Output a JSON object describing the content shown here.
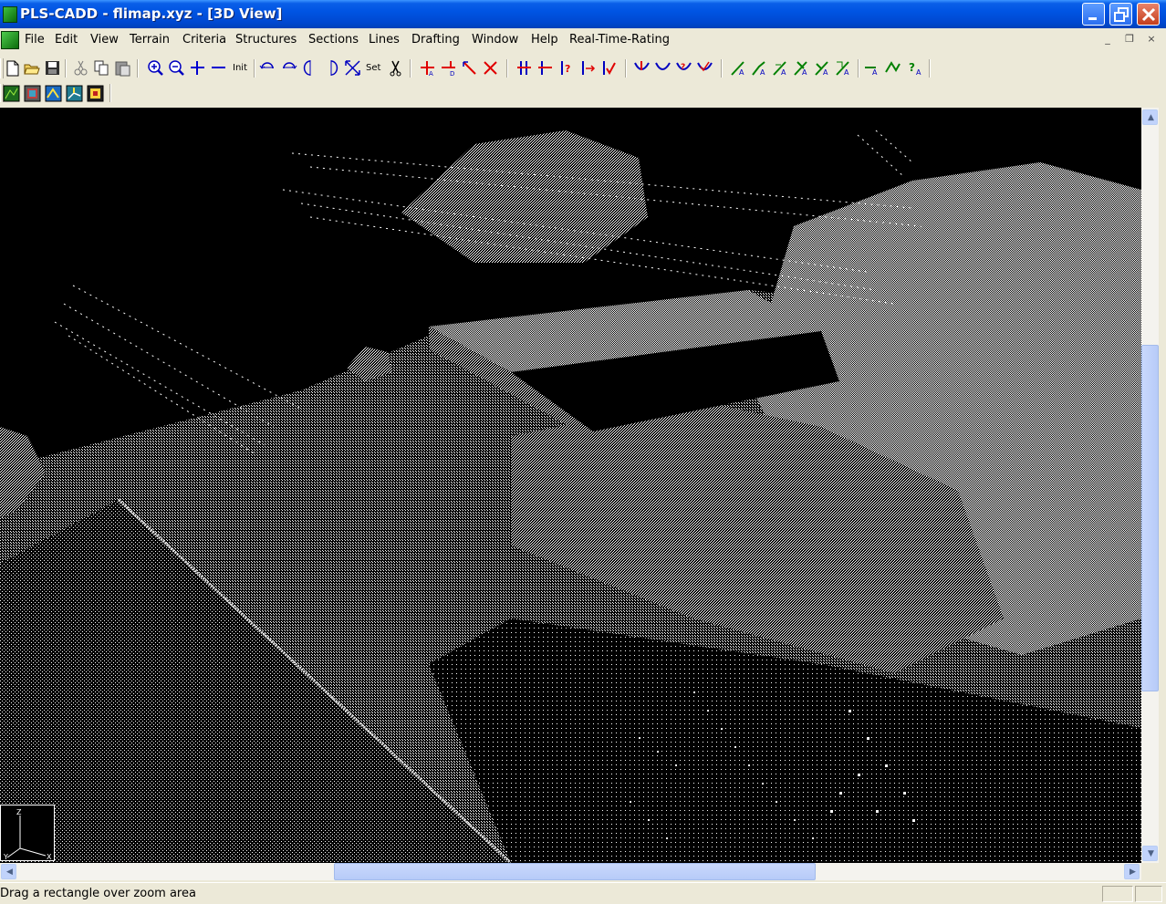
{
  "window": {
    "title": "PLS-CADD - flimap.xyz - [3D View]",
    "title_bar_color": "#0054e3",
    "controls": [
      "minimize",
      "maximize",
      "close"
    ]
  },
  "menubar": {
    "items": [
      "File",
      "Edit",
      "View",
      "Terrain",
      "Criteria",
      "Structures",
      "Sections",
      "Lines",
      "Drafting",
      "Window",
      "Help",
      "Real-Time-Rating"
    ],
    "mdi_controls": [
      "_",
      "❐",
      "×"
    ]
  },
  "toolbar": {
    "zoom_init_label": "Init",
    "set_label": "Set",
    "groups": {
      "file": [
        "new-file-icon",
        "open-folder-icon",
        "save-icon"
      ],
      "edit": [
        "cut-icon",
        "copy-icon",
        "paste-icon"
      ],
      "zoom": [
        "zoom-in-icon",
        "zoom-out-icon",
        "plus-icon",
        "minus-icon"
      ],
      "rotate": [
        "rotate-left-icon",
        "rotate-right-icon",
        "rotate-up-icon",
        "rotate-down-icon",
        "zoom-extents-icon",
        "scissors-icon"
      ],
      "section": [
        "add-section-icon",
        "delete-section-icon",
        "move-section-icon",
        "cut-section-icon"
      ],
      "structure": [
        "add-structure-icon",
        "delete-structure-icon",
        "structure-info-icon",
        "move-structure-icon",
        "check-structure-icon"
      ],
      "sag": [
        "sag-tension-icon",
        "sag-icon",
        "sag-info-icon",
        "sag-check-icon"
      ],
      "report": [
        "report-a-icon",
        "report-b-icon",
        "report-c-icon",
        "report-d-icon",
        "report-e-icon",
        "report-f-icon",
        "report-g-icon",
        "report-h-icon",
        "report-info-icon"
      ],
      "views": [
        "plan-view-icon",
        "profile-view-icon",
        "section-view-icon",
        "3d-view-icon",
        "sheet-view-icon"
      ]
    },
    "accent_red": "#e00000",
    "accent_blue": "#0000d0",
    "accent_green": "#008000"
  },
  "viewport": {
    "background": "#000000",
    "point_color": "#ffffff",
    "axis_labels": [
      "Z",
      "Y",
      "X"
    ]
  },
  "status": {
    "text": "Drag a rectangle over zoom area"
  }
}
